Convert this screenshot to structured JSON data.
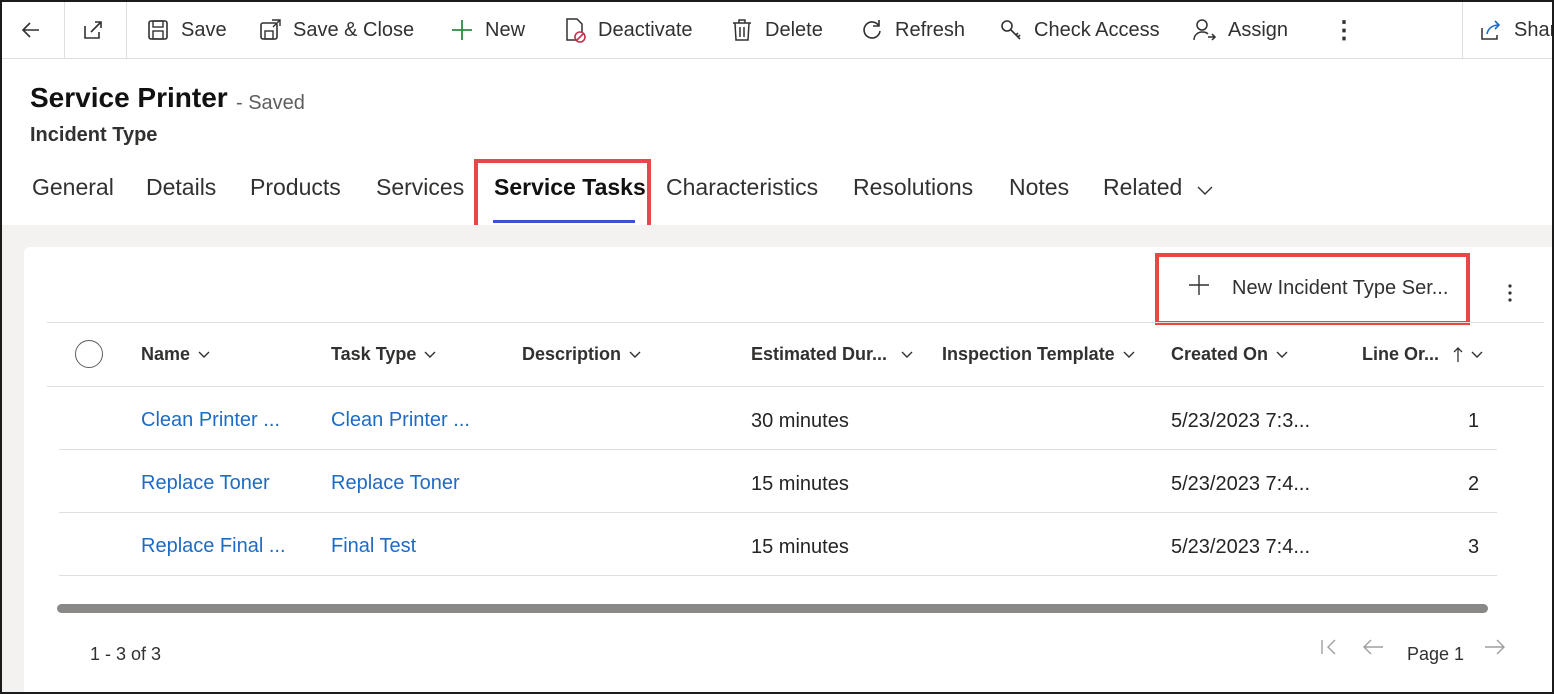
{
  "toolbar": {
    "save": "Save",
    "save_close": "Save & Close",
    "new": "New",
    "deactivate": "Deactivate",
    "delete": "Delete",
    "refresh": "Refresh",
    "check_access": "Check Access",
    "assign": "Assign",
    "share": "Shar"
  },
  "record": {
    "title": "Service Printer",
    "status": "- Saved",
    "entity": "Incident Type"
  },
  "tabs": [
    {
      "label": "General"
    },
    {
      "label": "Details"
    },
    {
      "label": "Products"
    },
    {
      "label": "Services"
    },
    {
      "label": "Service Tasks",
      "active": true
    },
    {
      "label": "Characteristics"
    },
    {
      "label": "Resolutions"
    },
    {
      "label": "Notes"
    },
    {
      "label": "Related"
    }
  ],
  "subgrid": {
    "new_button": "New Incident Type Ser...",
    "columns": [
      "Name",
      "Task Type",
      "Description",
      "Estimated Dur...",
      "Inspection Template",
      "Created On",
      "Line Or..."
    ],
    "rows": [
      {
        "name": "Clean Printer ...",
        "task_type": "Clean Printer ...",
        "description": "",
        "duration": "30 minutes",
        "inspection": "",
        "created_on": "5/23/2023 7:3...",
        "line_order": "1"
      },
      {
        "name": "Replace Toner",
        "task_type": "Replace Toner",
        "description": "",
        "duration": "15 minutes",
        "inspection": "",
        "created_on": "5/23/2023 7:4...",
        "line_order": "2"
      },
      {
        "name": "Replace Final ...",
        "task_type": "Final Test",
        "description": "",
        "duration": "15 minutes",
        "inspection": "",
        "created_on": "5/23/2023 7:4...",
        "line_order": "3"
      }
    ],
    "record_count": "1 - 3 of 3",
    "page_label": "Page 1"
  },
  "colors": {
    "highlight": "#e8474a",
    "link": "#1e6bc5",
    "tab_underline": "#3a53d6"
  }
}
